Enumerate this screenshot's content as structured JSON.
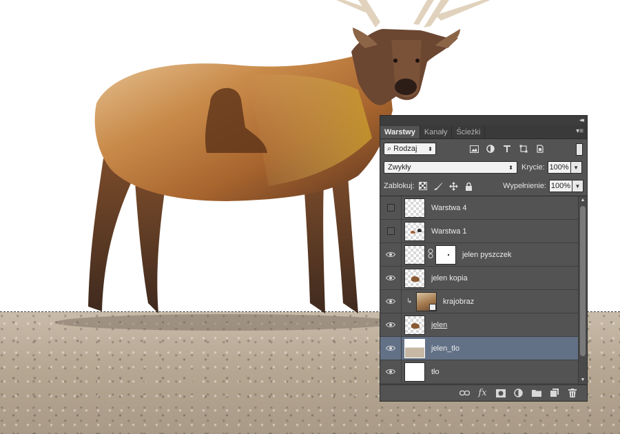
{
  "panel": {
    "tabs": [
      {
        "label": "Warstwy",
        "active": true
      },
      {
        "label": "Kanały",
        "active": false
      },
      {
        "label": "Ścieżki",
        "active": false
      }
    ],
    "filter": {
      "value": "Rodzaj"
    },
    "blend_mode": "Zwykły",
    "opacity": {
      "label": "Krycie:",
      "value": "100%"
    },
    "lock_label": "Zablokuj:",
    "fill": {
      "label": "Wypełnienie:",
      "value": "100%"
    },
    "layers": [
      {
        "name": "Warstwa 4",
        "visible": false,
        "selected": false
      },
      {
        "name": "Warstwa 1",
        "visible": false,
        "selected": false
      },
      {
        "name": "jelen pyszczek",
        "visible": true,
        "selected": false,
        "has_mask": true
      },
      {
        "name": "jelen kopia",
        "visible": true,
        "selected": false
      },
      {
        "name": "krajobraz",
        "visible": true,
        "selected": false,
        "clipped": true
      },
      {
        "name": "jelen",
        "visible": true,
        "selected": false
      },
      {
        "name": "jelen_tlo",
        "visible": true,
        "selected": true
      },
      {
        "name": "tło",
        "visible": true,
        "selected": false
      }
    ]
  },
  "colors": {
    "panel_bg": "#535353",
    "selected_row": "#637187",
    "tab_bar": "#3a3a3a"
  }
}
